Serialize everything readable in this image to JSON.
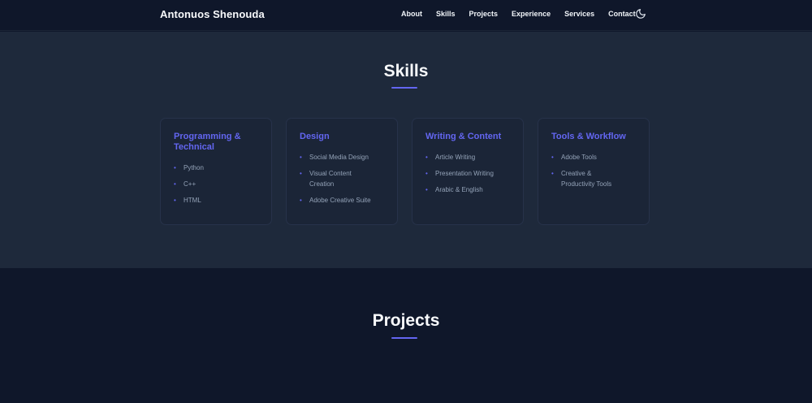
{
  "header": {
    "brand": "Antonuos Shenouda",
    "nav": [
      "About",
      "Skills",
      "Projects",
      "Experience",
      "Services",
      "Contact"
    ],
    "theme_icon": "moon-icon"
  },
  "skills": {
    "title": "Skills",
    "cards": [
      {
        "title": "Programming & Technical",
        "items": [
          "Python",
          "C++",
          "HTML"
        ]
      },
      {
        "title": "Design",
        "items": [
          "Social Media Design",
          "Visual Content Creation",
          "Adobe Creative Suite"
        ]
      },
      {
        "title": "Writing & Content",
        "items": [
          "Article Writing",
          "Presentation Writing",
          "Arabic & English"
        ]
      },
      {
        "title": "Tools & Workflow",
        "items": [
          "Adobe Tools",
          "Creative & Productivity Tools"
        ]
      }
    ]
  },
  "projects": {
    "title": "Projects"
  },
  "colors": {
    "accent": "#6366f1",
    "background": "#0f172a",
    "section_background": "#1e293b"
  }
}
